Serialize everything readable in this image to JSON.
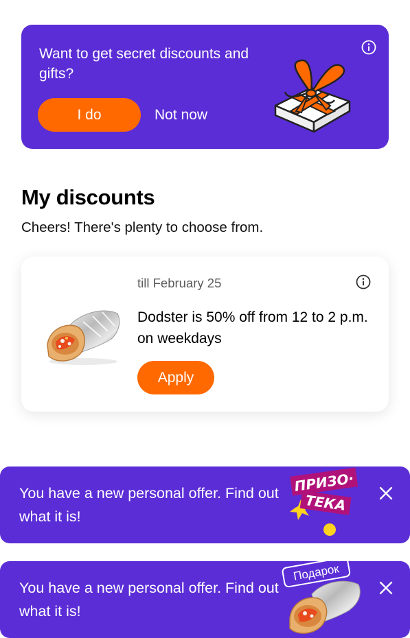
{
  "promo": {
    "question": "Want to get secret discounts and gifts?",
    "accept_label": "I do",
    "decline_label": "Not now",
    "info_icon": "info-icon",
    "art_icon": "gift-box-icon"
  },
  "discounts": {
    "title": "My discounts",
    "subtitle": "Cheers! There's plenty to choose from.",
    "items": [
      {
        "date": "till February 25",
        "description": "Dodster is 50% off from 12 to 2 p.m. on weekdays",
        "apply_label": "Apply",
        "image_icon": "dodster-wrap-icon"
      }
    ]
  },
  "banners": [
    {
      "text": "You have a new personal offer. Find out what it is!",
      "badge_line1": "ПРИЗО·",
      "badge_line2": "ТЕКА",
      "close_icon": "close-icon"
    },
    {
      "text": "You have a new personal offer. Find out what it is!",
      "badge": "Подарок",
      "close_icon": "close-icon"
    }
  ],
  "colors": {
    "brand_purple": "#5b2dd6",
    "accent_orange": "#ff6900",
    "prizo_pink": "#b0127a",
    "sticker_yellow": "#ffd21f"
  }
}
